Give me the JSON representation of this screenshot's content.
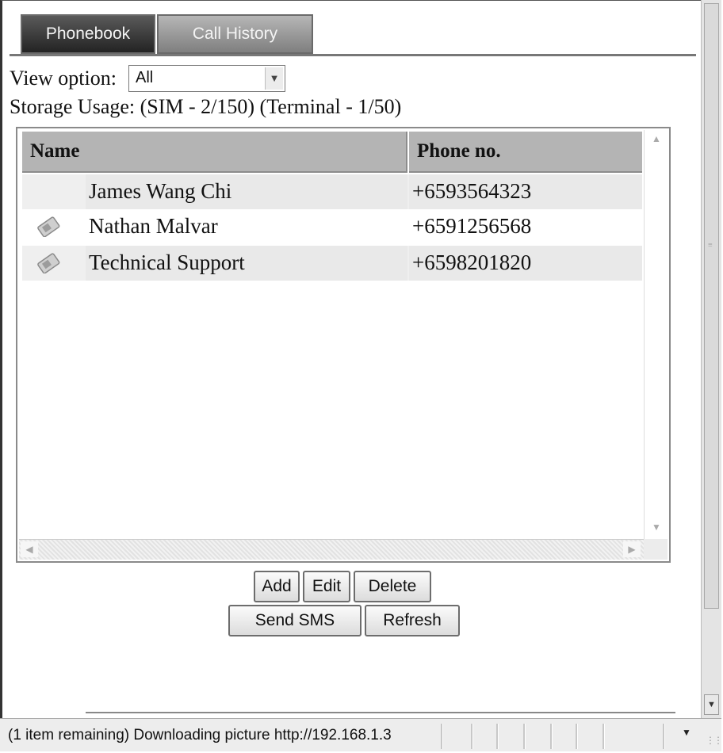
{
  "tabs": {
    "phonebook": "Phonebook",
    "call_history": "Call History"
  },
  "view_option": {
    "label": "View option:",
    "selected": "All"
  },
  "storage_usage": "Storage Usage: (SIM - 2/150)   (Terminal - 1/50)",
  "table": {
    "headers": {
      "name": "Name",
      "phone": "Phone no."
    },
    "rows": [
      {
        "name": "James Wang Chi",
        "phone": "+6593564323",
        "icon": ""
      },
      {
        "name": "Nathan Malvar",
        "phone": "+6591256568",
        "icon": "sim-card-icon"
      },
      {
        "name": "Technical Support",
        "phone": "+6598201820",
        "icon": "sim-card-icon"
      }
    ]
  },
  "buttons": {
    "add": "Add",
    "edit": "Edit",
    "delete": "Delete",
    "send_sms": "Send SMS",
    "refresh": "Refresh"
  },
  "status_bar": {
    "text": "(1 item remaining) Downloading picture http://192.168.1.3"
  },
  "colors": {
    "tab_active": "#232323",
    "tab_inactive": "#8f8f8f",
    "header_bg": "#b4b4b4"
  }
}
